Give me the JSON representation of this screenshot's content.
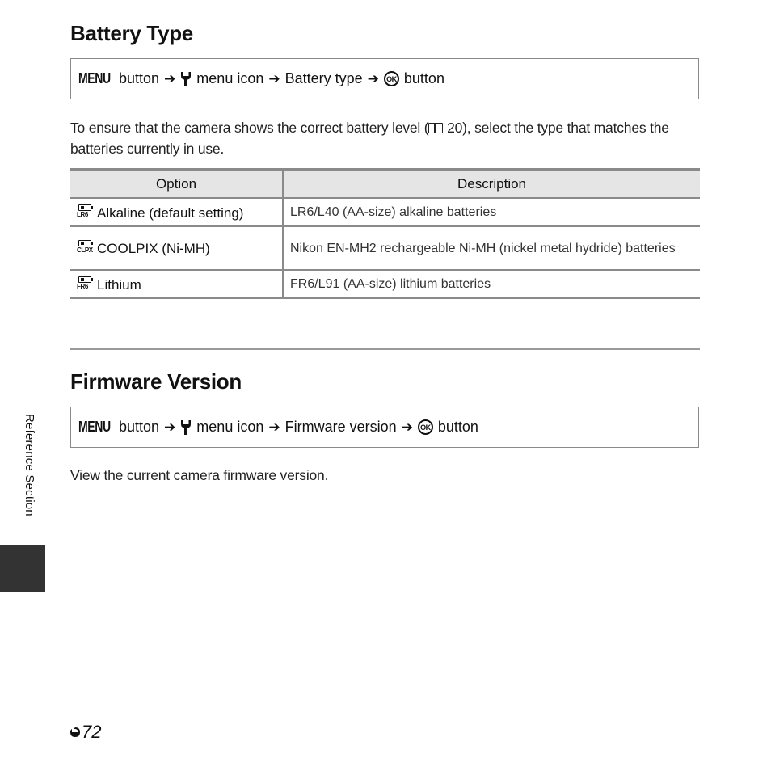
{
  "sections": [
    {
      "title": "Battery Type",
      "path": {
        "menu_label": "MENU",
        "steps": [
          "button",
          "menu icon",
          "Battery type",
          "button"
        ],
        "arrow": "➔"
      },
      "intro": {
        "before_ref": "To ensure that the camera shows the correct battery level (",
        "ref_page": "20",
        "after_ref": "), select the type that matches the batteries currently in use."
      },
      "table": {
        "headers": [
          "Option",
          "Description"
        ],
        "rows": [
          {
            "icon": "battery-lr6-icon",
            "icon_label": "LR6",
            "option": "Alkaline (default setting)",
            "description": "LR6/L40 (AA-size) alkaline batteries"
          },
          {
            "icon": "battery-clpx-icon",
            "icon_label": "CLPX",
            "option": "COOLPIX (Ni-MH)",
            "description": "Nikon EN-MH2 rechargeable Ni-MH (nickel metal hydride) batteries"
          },
          {
            "icon": "battery-fr6-icon",
            "icon_label": "FR6",
            "option": "Lithium",
            "description": "FR6/L91 (AA-size) lithium batteries"
          }
        ]
      }
    },
    {
      "title": "Firmware Version",
      "path": {
        "menu_label": "MENU",
        "steps": [
          "button",
          "menu icon",
          "Firmware version",
          "button"
        ],
        "arrow": "➔"
      },
      "body": "View the current camera firmware version."
    }
  ],
  "side_label": "Reference Section",
  "page_number": "72",
  "ok_label": "OK",
  "colors": {
    "rule": "#8a8a8a",
    "header_bg": "#e5e5e5",
    "side_tab": "#333333"
  }
}
